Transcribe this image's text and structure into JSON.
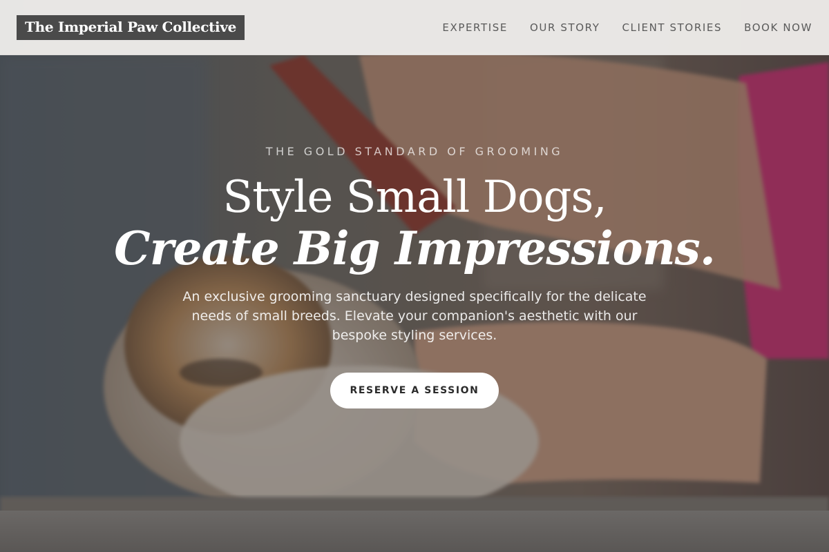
{
  "brand": {
    "name": "The Imperial Paw Collective"
  },
  "nav": {
    "items": [
      {
        "label": "EXPERTISE"
      },
      {
        "label": "OUR STORY"
      },
      {
        "label": "CLIENT STORIES"
      },
      {
        "label": "BOOK NOW"
      }
    ]
  },
  "hero": {
    "eyebrow": "THE GOLD STANDARD OF GROOMING",
    "headline_line1": "Style Small Dogs,",
    "headline_line2": "Create Big Impressions.",
    "description": "An exclusive grooming sanctuary designed specifically for the delicate needs of small breeds. Elevate your companion's aesthetic with our bespoke styling services.",
    "cta_label": "RESERVE A SESSION"
  },
  "colors": {
    "header_bg": "#eeecea",
    "logo_bg": "#4a4a4a",
    "nav_text": "#5a5a5a",
    "cta_bg": "#ffffff",
    "cta_text": "#2a2a2a"
  }
}
